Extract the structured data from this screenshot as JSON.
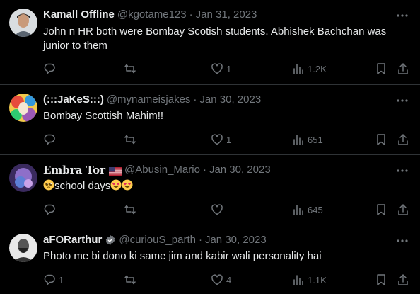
{
  "colors": {
    "background": "#000000",
    "text": "#e7e9ea",
    "muted": "#71767b",
    "divider": "#2f3336",
    "verified": "#71767b"
  },
  "tweets": [
    {
      "name": "Kamall Offline",
      "handle": "@kgotame123",
      "separator": "·",
      "date": "Jan 31, 2023",
      "text": "John n HR both were Bombay Scotish students. Abhishek Bachchan was junior to them",
      "replies": "",
      "retweets": "",
      "likes": "1",
      "views": "1.2K",
      "avatar_icon": "user-avatar-photo"
    },
    {
      "name": "(:::JaKeS:::)",
      "handle": "@mynameisjakes",
      "separator": "·",
      "date": "Jan 30, 2023",
      "text": "Bombay Scottish Mahim!!",
      "replies": "",
      "retweets": "",
      "likes": "1",
      "views": "651",
      "avatar_icon": "colorful-avatar"
    },
    {
      "name": "Embra Tor",
      "handle": "@Abusin_Mario",
      "separator": "·",
      "date": "Jan 30, 2023",
      "text": "school days",
      "replies": "",
      "retweets": "",
      "likes": "",
      "views": "645",
      "avatar_icon": "purple-avatar",
      "flag_icon": "us-flag-icon",
      "lead_emoji": "pleading-face-emoji",
      "trail_emojis": [
        "heart-eyes-emoji",
        "heart-eyes-emoji"
      ]
    },
    {
      "name": "aFORarthur",
      "handle": "@curiouS_parth",
      "separator": "·",
      "date": "Jan 30, 2023",
      "text": "Photo me bi dono ki same jim and kabir wali personality hai",
      "replies": "1",
      "retweets": "",
      "likes": "4",
      "views": "1.1K",
      "avatar_icon": "bearded-man-avatar",
      "verified_icon": "verified-badge-icon"
    }
  ]
}
